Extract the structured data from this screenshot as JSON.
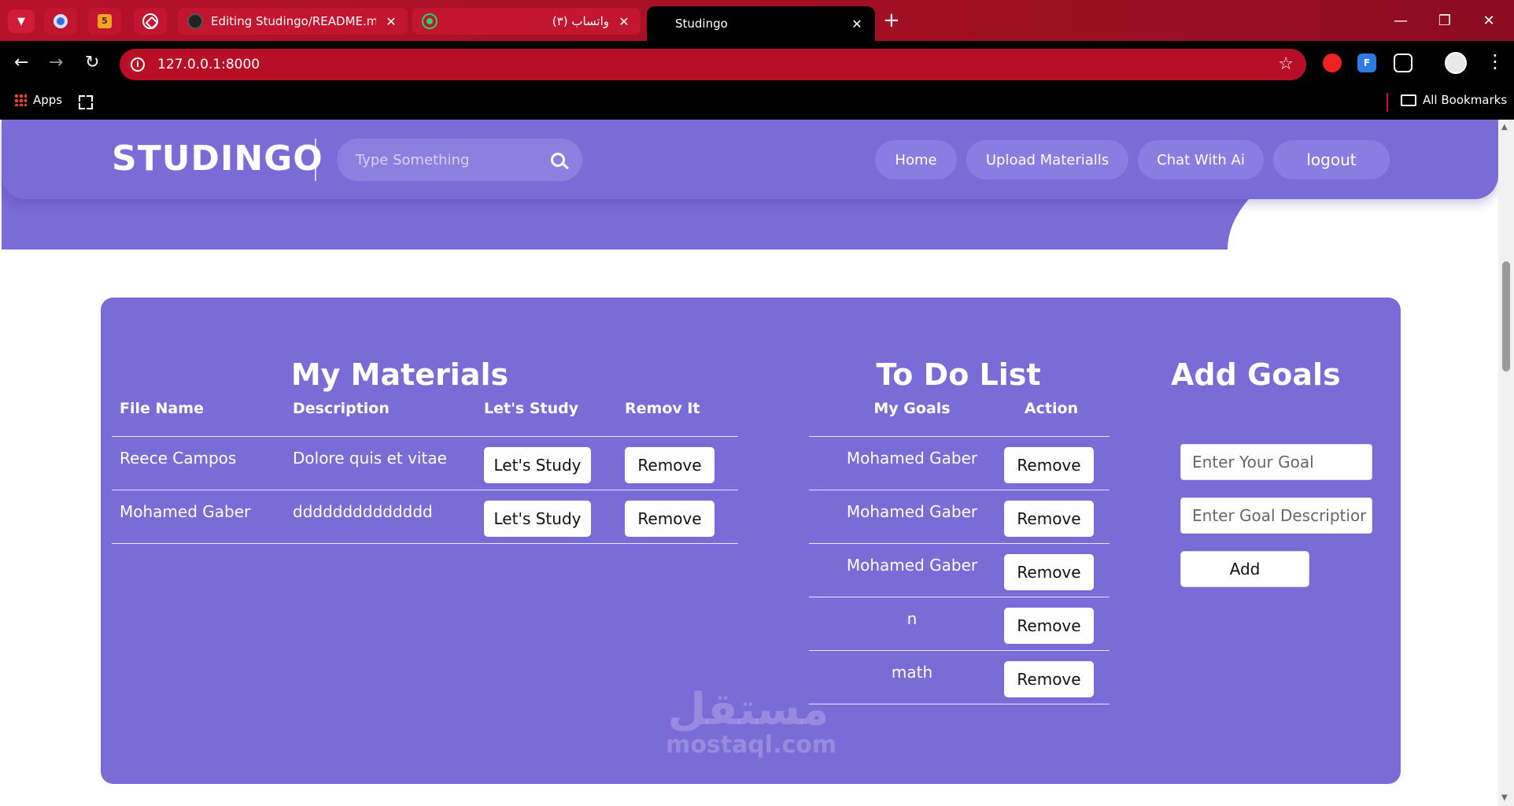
{
  "browser": {
    "tabs": [
      {
        "title": "Editing Studingo/README.md a"
      },
      {
        "title": "(٣) واتساب"
      },
      {
        "title": "Studingo",
        "active": true
      }
    ],
    "favicon_square_label": "5",
    "address": "127.0.0.1:8000",
    "bookmarks": {
      "apps": "Apps",
      "all": "All Bookmarks"
    },
    "ext_label": "F"
  },
  "site": {
    "logo": "STUDINGO",
    "search_placeholder": "Type Something",
    "nav": [
      "Home",
      "Upload Materialls",
      "Chat With Ai",
      "logout"
    ]
  },
  "materials": {
    "title": "My Materials",
    "headers": [
      "File Name",
      "Description",
      "Let's Study",
      "Remov It"
    ],
    "rows": [
      {
        "file": "Reece Campos",
        "desc": "Dolore quis et vitae",
        "study": "Let's Study",
        "remove": "Remove"
      },
      {
        "file": "Mohamed Gaber",
        "desc": "dddddddddddddd",
        "study": "Let's Study",
        "remove": "Remove"
      }
    ]
  },
  "todo": {
    "title": "To Do List",
    "headers": [
      "My Goals",
      "Action"
    ],
    "rows": [
      {
        "goal": "Mohamed Gaber",
        "action": "Remove"
      },
      {
        "goal": "Mohamed Gaber",
        "action": "Remove"
      },
      {
        "goal": "Mohamed Gaber",
        "action": "Remove"
      },
      {
        "goal": "n",
        "action": "Remove"
      },
      {
        "goal": "math",
        "action": "Remove"
      }
    ]
  },
  "goals": {
    "title": "Add Goals",
    "goal_placeholder": "Enter Your Goal",
    "desc_placeholder": "Enter Goal Descriptior",
    "add_label": "Add"
  },
  "watermark": {
    "arabic": "مستقل",
    "latin": "mostaql.com"
  },
  "colors": {
    "primary": "#7b6bd6",
    "browser_accent": "#b5132a"
  }
}
